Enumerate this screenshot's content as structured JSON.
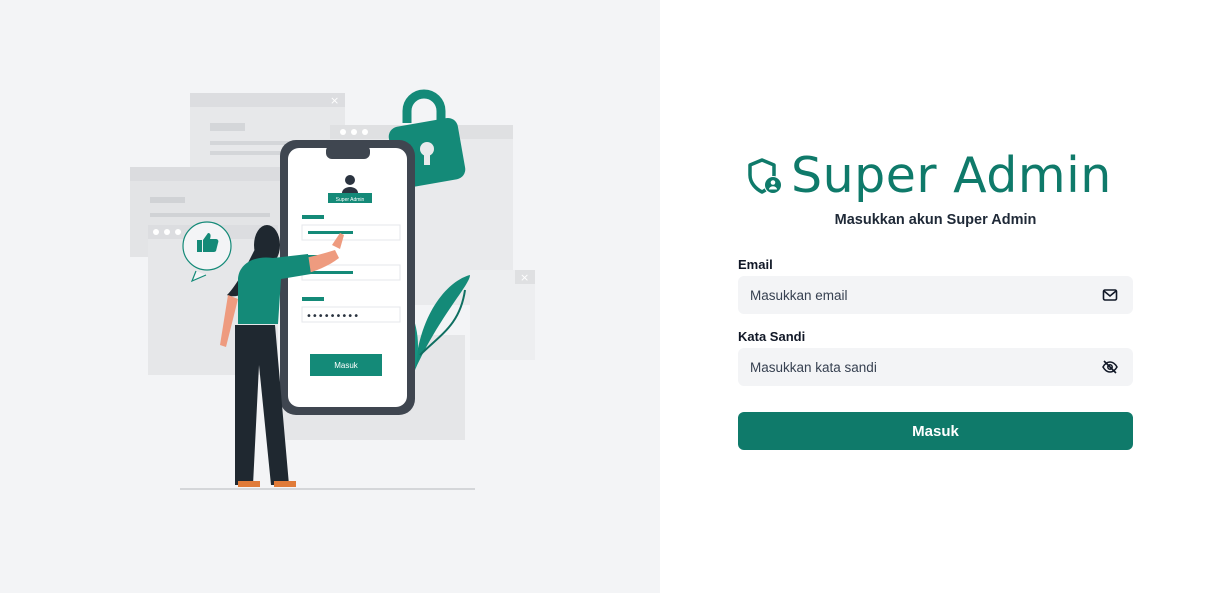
{
  "colors": {
    "accent": "#0f7a6a",
    "left_panel_bg": "#f3f4f6",
    "input_bg": "#f3f4f6"
  },
  "brand": {
    "title": "Super Admin",
    "logo_icon": "shield-user-icon"
  },
  "subtitle": "Masukkan akun Super Admin",
  "illustration": {
    "phone_header": "Super Admin",
    "phone_button": "Masuk",
    "phone_password_mask": "•••••••••"
  },
  "form": {
    "email": {
      "label": "Email",
      "placeholder": "Masukkan email",
      "value": "",
      "icon": "mail-icon"
    },
    "password": {
      "label": "Kata Sandi",
      "placeholder": "Masukkan kata sandi",
      "value": "",
      "icon": "eye-off-icon"
    },
    "submit_label": "Masuk"
  }
}
